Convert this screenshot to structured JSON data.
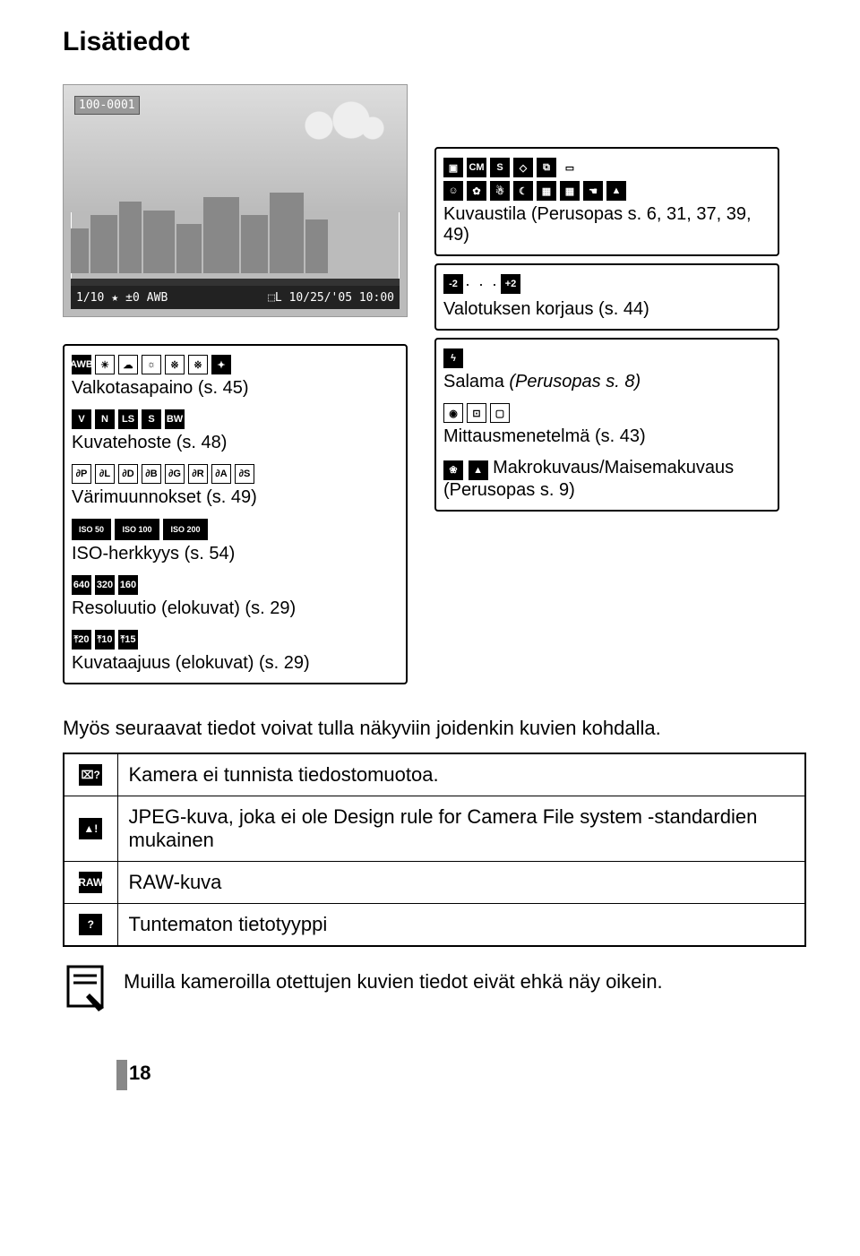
{
  "title": "Lisätiedot",
  "camera": {
    "counter": "100-0001",
    "left_vals": [
      "1/10",
      "★",
      "±0",
      "AWB"
    ],
    "right_vals": [
      "⬚L 10/25/'05 10:00"
    ]
  },
  "leftBox": {
    "whiteBalance": {
      "icons": [
        "AWB",
        "☀",
        "☁",
        "☼",
        "※",
        "※",
        "✦"
      ],
      "label": "Valkotasapaino (s. 45)"
    },
    "imageEffect": {
      "icons": [
        "V",
        "N",
        "LS",
        "S",
        "BW"
      ],
      "label": "Kuvatehoste (s. 48)"
    },
    "colorTransforms": {
      "icons": [
        "P",
        "L",
        "D",
        "B",
        "G",
        "R",
        "A",
        "S"
      ],
      "label": "Värimuunnokset (s. 49)"
    },
    "iso": {
      "icons": [
        "ISO 50",
        "ISO 100",
        "ISO 200"
      ],
      "label": "ISO-herkkyys (s. 54)"
    },
    "resolution": {
      "icons": [
        "640",
        "320",
        "160"
      ],
      "label": "Resoluutio (elokuvat) (s. 29)"
    },
    "framerate": {
      "icons": [
        "20",
        "10",
        "15"
      ],
      "label": "Kuvataajuus (elokuvat) (s. 29)"
    }
  },
  "rightBoxes": {
    "shooting": {
      "iconRows": [
        [
          "▣",
          "CM",
          "S",
          "◇",
          "⧉",
          "▭"
        ],
        [
          "☺",
          "✿",
          "☃",
          "☾",
          "▦",
          "▦",
          "☚",
          "▲"
        ]
      ],
      "label": "Kuvaustila ",
      "ref": "(Perusopas s. ",
      "pages": "6, 31, 37, 39, 49)"
    },
    "exposure": {
      "leftTag": "-2",
      "rightTag": "+2",
      "label": "Valotuksen korjaus (s. 44)"
    },
    "flash": {
      "label": "Salama ",
      "ref": "(Perusopas s. 8)"
    },
    "metering": {
      "label": "Mittausmenetelmä (s. 43)"
    },
    "macro": {
      "label": " Makrokuvaus/Maisemakuvaus",
      "ref": "(Perusopas s. 9)"
    }
  },
  "paragraph": "Myös seuraavat tiedot voivat tulla näkyviin joidenkin kuvien kohdalla.",
  "table": {
    "rows": [
      {
        "icon": "⌧?",
        "text": "Kamera ei tunnista tiedostomuotoa."
      },
      {
        "icon": "⚠",
        "text": "JPEG-kuva, joka ei ole Design rule for Camera File system -standardien mukainen"
      },
      {
        "icon": "RAW",
        "text": "RAW-kuva"
      },
      {
        "icon": "?",
        "text": "Tuntematon tietotyyppi"
      }
    ]
  },
  "footer": "Muilla kameroilla otettujen kuvien tiedot eivät ehkä näy oikein.",
  "pageNumber": "18"
}
